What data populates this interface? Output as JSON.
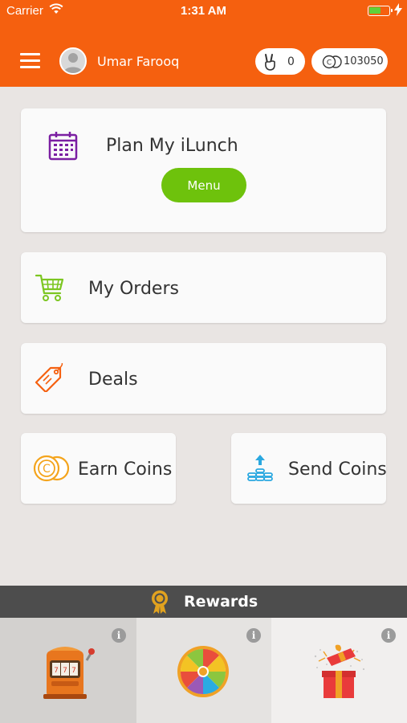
{
  "status_bar": {
    "carrier": "Carrier",
    "time": "1:31 AM"
  },
  "header": {
    "username": "Umar Farooq",
    "hand_count": "0",
    "coin_count": "103050"
  },
  "cards": {
    "plan": {
      "title": "Plan My iLunch",
      "button": "Menu"
    },
    "orders": {
      "title": "My Orders"
    },
    "deals": {
      "title": "Deals"
    },
    "earn": {
      "title": "Earn Coins"
    },
    "send": {
      "title": "Send Coins"
    }
  },
  "rewards": {
    "title": "Rewards",
    "info_glyph": "i"
  },
  "colors": {
    "brand_orange": "#f5600f",
    "menu_green": "#6ec20c",
    "calendar_purple": "#7b1fa2",
    "cart_green": "#7cc621",
    "tag_orange": "#f5600f",
    "coin_orange": "#f4a41c",
    "send_blue": "#2aa8e0",
    "rewards_bar": "#4d4d4d"
  },
  "icons": [
    "menu-icon",
    "avatar-icon",
    "peace-hand-icon",
    "coin-icon",
    "calendar-icon",
    "cart-icon",
    "tag-icon",
    "earn-coin-icon",
    "send-coins-icon",
    "medal-icon",
    "slot-machine-icon",
    "spin-wheel-icon",
    "gift-box-icon",
    "info-icon"
  ]
}
